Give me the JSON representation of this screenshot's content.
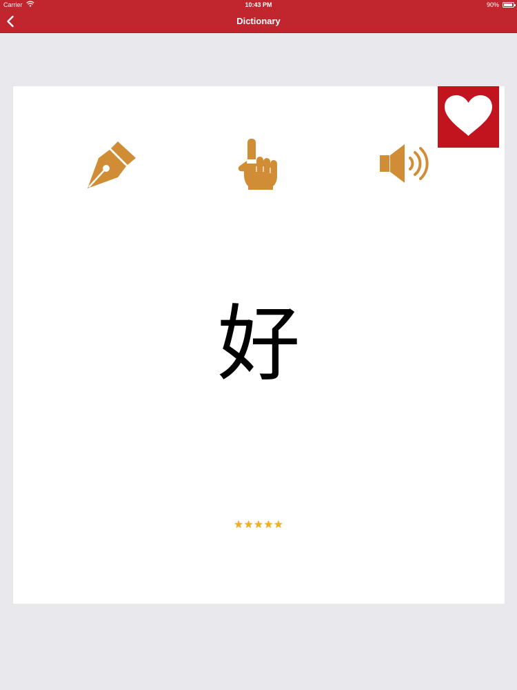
{
  "status_bar": {
    "carrier": "Carrier",
    "time": "10:43 PM",
    "battery_percent_label": "90%",
    "battery_level": 0.9
  },
  "nav": {
    "title": "Dictionary",
    "back_icon": "chevron-left-icon"
  },
  "card": {
    "favorite_icon": "heart-icon",
    "tools": [
      {
        "icon": "pen-nib-icon"
      },
      {
        "icon": "pointing-hand-icon"
      },
      {
        "icon": "speaker-icon"
      }
    ],
    "character": "好",
    "rating": {
      "stars": 5,
      "max": 5,
      "display": "★★★★★"
    }
  },
  "colors": {
    "brand_red": "#c1262e",
    "favorite_red": "#c2141e",
    "tool_gold": "#d08d35",
    "background": "#e9e8ec"
  }
}
